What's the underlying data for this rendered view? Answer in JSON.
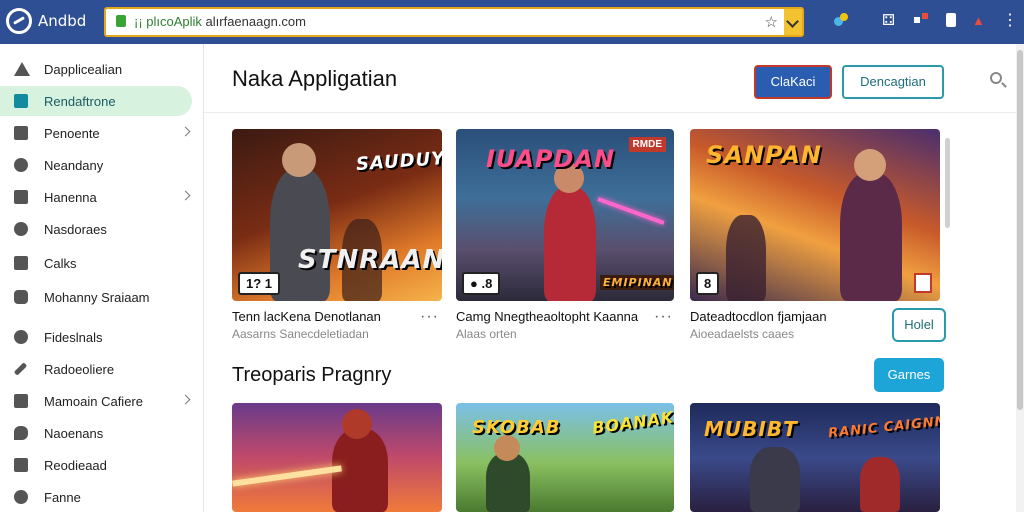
{
  "browser": {
    "brand": "Andbd",
    "url_green": "¡¡ plıcoAplik",
    "url_rest": " alırfaenaagn.com",
    "icons": [
      "app-logo-icon",
      "lock-icon",
      "star-icon",
      "dropdown-icon",
      "extension-icon",
      "puzzle-icon",
      "grid-icon",
      "profile-icon",
      "notification-icon",
      "menu-icon"
    ]
  },
  "sidebar": {
    "items": [
      {
        "label": "Dapplicealian",
        "icon": "warning-icon"
      },
      {
        "label": "Rendaftrone",
        "icon": "app-icon",
        "active": true
      },
      {
        "label": "Penoente",
        "icon": "mail-icon",
        "chevron": true
      },
      {
        "label": "Neandany",
        "icon": "user-icon"
      },
      {
        "label": "Hanenna",
        "icon": "mail-icon",
        "chevron": true
      },
      {
        "label": "Nasdoraes",
        "icon": "gear-icon"
      },
      {
        "label": "Calks",
        "icon": "check-icon"
      },
      {
        "label": "Mohanny Sraiaam",
        "icon": "shield-icon"
      },
      {
        "label": "Fideslnals",
        "icon": "person-icon"
      },
      {
        "label": "Radoeoliere",
        "icon": "wrench-icon"
      },
      {
        "label": "Mamoain Cafiere",
        "icon": "folder-icon",
        "chevron": true
      },
      {
        "label": "Naoenans",
        "icon": "chat-icon"
      },
      {
        "label": "Reodieaad",
        "icon": "mail-icon"
      },
      {
        "label": "Fanne",
        "icon": "person-icon"
      }
    ]
  },
  "main": {
    "title": "Naka Appligatian",
    "primary_button": "ClaKaci",
    "secondary_button": "Dencagtian",
    "cards": [
      {
        "art_title_top": "SAUDUY",
        "art_title_main": "STNRAAN",
        "badge": "1? 1",
        "name": "Tenn lacKena Denotlanan",
        "sub": "Aasarns Sanecdeletiadan"
      },
      {
        "art_title_top": "IUAPDAN",
        "art_title_main": "EMIPINAN",
        "corner": "RMDE",
        "badge": "● .8",
        "name": "Camg Nnegtheaoltopht Kaanna",
        "sub": "Alaas orten"
      },
      {
        "art_title_top": "SANPAN",
        "badge": "8",
        "name": "Dateadtocdlon fjamjaan",
        "sub": "Aioeadaelsts caaes"
      }
    ],
    "small_button": "Holel",
    "section_title": "Treoparis Pragnry",
    "games_button": "Garnes",
    "bottom_cards": [
      {
        "art_title": ""
      },
      {
        "art_title": "SKOBAB",
        "art_title2": "BOANAK"
      },
      {
        "art_title": "MUBIBT",
        "art_title2": "RANIC CAIGNNES"
      }
    ]
  }
}
